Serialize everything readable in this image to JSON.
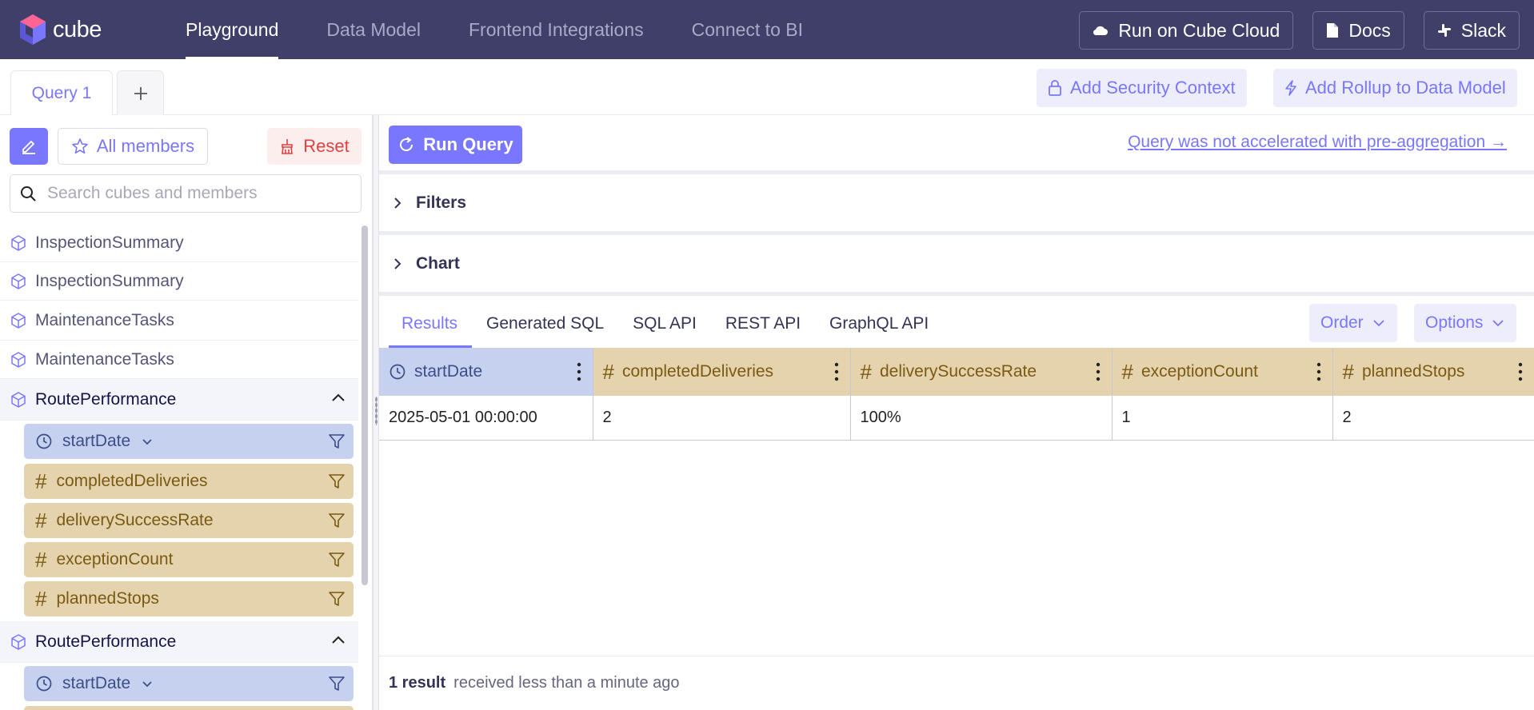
{
  "app": {
    "logo_text": "cube"
  },
  "nav": {
    "tabs": [
      "Playground",
      "Data Model",
      "Frontend Integrations",
      "Connect to BI"
    ],
    "buttons": {
      "cloud": "Run on Cube Cloud",
      "docs": "Docs",
      "slack": "Slack"
    }
  },
  "query_tabs": {
    "active": "Query 1",
    "add": "+"
  },
  "toolbar": {
    "security": "Add Security Context",
    "rollup": "Add Rollup to Data Model"
  },
  "sidebar": {
    "all_members": "All members",
    "reset": "Reset",
    "search_placeholder": "Search cubes and members",
    "cubes": [
      "InspectionSummary",
      "InspectionSummary",
      "MaintenanceTasks",
      "MaintenanceTasks",
      "RoutePerformance",
      "RoutePerformance"
    ],
    "members": {
      "time": "startDate",
      "measures": [
        "completedDeliveries",
        "deliverySuccessRate",
        "exceptionCount",
        "plannedStops"
      ]
    }
  },
  "main": {
    "run_query": "Run Query",
    "preagg_link": "Query was not accelerated with pre-aggregation →",
    "filters": "Filters",
    "chart": "Chart",
    "result_tabs": [
      "Results",
      "Generated SQL",
      "SQL API",
      "REST API",
      "GraphQL API"
    ],
    "order": "Order",
    "options": "Options",
    "table": {
      "columns": [
        "startDate",
        "completedDeliveries",
        "deliverySuccessRate",
        "exceptionCount",
        "plannedStops"
      ],
      "rows": [
        [
          "2025-05-01 00:00:00",
          "2",
          "100%",
          "1",
          "2"
        ]
      ]
    },
    "footer": {
      "count": "1 result",
      "received": "received less than a minute ago"
    }
  },
  "colors": {
    "accent": "#7a77ff",
    "nav_bg": "#3f3f69",
    "time_member": "#c5d1ee",
    "measure_member": "#e5d3ad"
  }
}
